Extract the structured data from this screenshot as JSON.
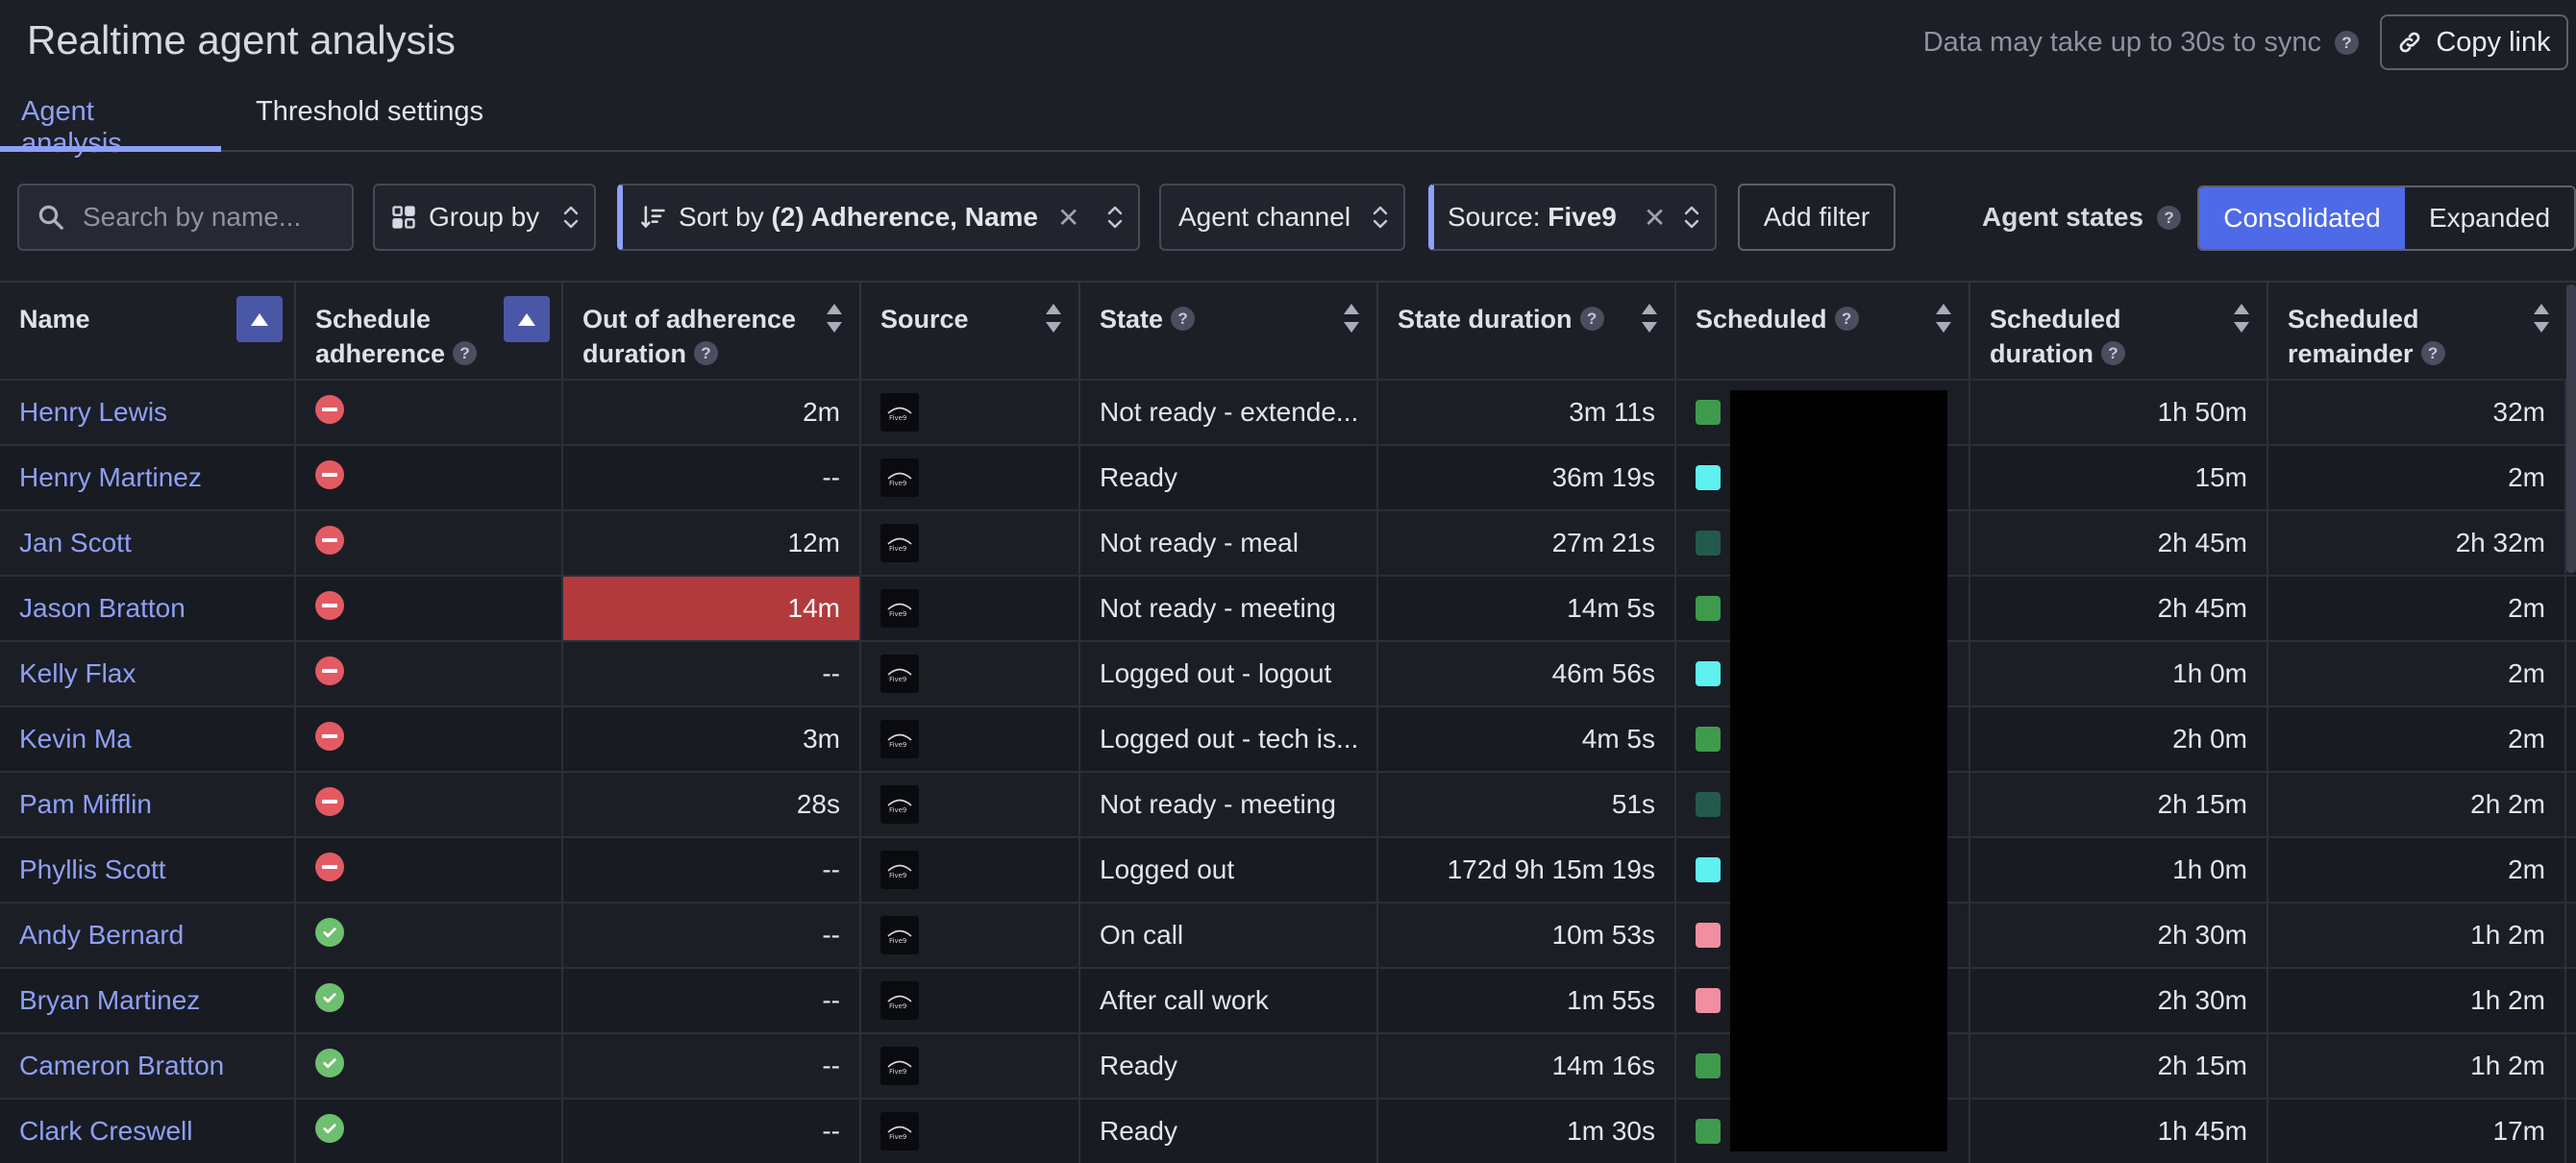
{
  "header": {
    "title": "Realtime agent analysis",
    "sync_note": "Data may take up to 30s to sync",
    "copy_link_label": "Copy link"
  },
  "tabs": [
    {
      "label": "Agent analysis",
      "active": true
    },
    {
      "label": "Threshold settings",
      "active": false
    }
  ],
  "toolbar": {
    "search_placeholder": "Search by name...",
    "group_by_label": "Group by",
    "sort_prefix": "Sort by",
    "sort_value": "(2) Adherence, Name",
    "channel_label": "Agent channel",
    "source_prefix": "Source:",
    "source_value": "Five9",
    "add_filter_label": "Add filter",
    "agent_states_label": "Agent states",
    "view_options": [
      "Consolidated",
      "Expanded"
    ],
    "selected_view": "Consolidated"
  },
  "columns": {
    "name": "Name",
    "adherence_1": "Schedule",
    "adherence_2": "adherence",
    "ooa_1": "Out of adherence",
    "ooa_2": "duration",
    "source": "Source",
    "state": "State",
    "state_duration": "State duration",
    "scheduled": "Scheduled",
    "sched_duration_1": "Scheduled",
    "sched_duration_2": "duration",
    "sched_remainder_1": "Scheduled",
    "sched_remainder_2": "remainder"
  },
  "colors": {
    "accent": "#8ea0f7",
    "primary_button": "#4e6ae8",
    "out_of_adherence": "#e45a63",
    "in_adherence": "#6fbf70",
    "alert_cell": "#b23a3d"
  },
  "rows": [
    {
      "name": "Henry Lewis",
      "adherence": "out",
      "ooa": "2m",
      "source_icon": "five9-logo-icon",
      "state": "Not ready - extende...",
      "state_duration": "3m 11s",
      "scheduled_color": "#3f9a4e",
      "sched_duration": "1h 50m",
      "remainder": "32m"
    },
    {
      "name": "Henry Martinez",
      "adherence": "out",
      "ooa": "--",
      "source_icon": "five9-logo-icon",
      "state": "Ready",
      "state_duration": "36m 19s",
      "scheduled_color": "#5ff0f0",
      "sched_duration": "15m",
      "remainder": "2m"
    },
    {
      "name": "Jan Scott",
      "adherence": "out",
      "ooa": "12m",
      "source_icon": "five9-logo-icon",
      "state": "Not ready - meal",
      "state_duration": "27m 21s",
      "scheduled_color": "#245a4b",
      "sched_duration": "2h 45m",
      "remainder": "2h 32m"
    },
    {
      "name": "Jason Bratton",
      "adherence": "out",
      "ooa": "14m",
      "ooa_alert": true,
      "source_icon": "five9-logo-icon",
      "state": "Not ready - meeting",
      "state_duration": "14m 5s",
      "scheduled_color": "#3f9a4e",
      "sched_duration": "2h 45m",
      "remainder": "2m"
    },
    {
      "name": "Kelly Flax",
      "adherence": "out",
      "ooa": "--",
      "source_icon": "five9-logo-icon",
      "state": "Logged out - logout",
      "state_duration": "46m 56s",
      "scheduled_color": "#5ff0f0",
      "sched_duration": "1h 0m",
      "remainder": "2m"
    },
    {
      "name": "Kevin Ma",
      "adherence": "out",
      "ooa": "3m",
      "source_icon": "five9-logo-icon",
      "state": "Logged out - tech is...",
      "state_duration": "4m 5s",
      "scheduled_color": "#3f9a4e",
      "sched_duration": "2h 0m",
      "remainder": "2m"
    },
    {
      "name": "Pam Mifflin",
      "adherence": "out",
      "ooa": "28s",
      "source_icon": "five9-logo-icon",
      "state": "Not ready - meeting",
      "state_duration": "51s",
      "scheduled_color": "#245a4b",
      "sched_duration": "2h 15m",
      "remainder": "2h 2m"
    },
    {
      "name": "Phyllis Scott",
      "adherence": "out",
      "ooa": "--",
      "source_icon": "five9-logo-icon",
      "state": "Logged out",
      "state_duration": "172d 9h 15m 19s",
      "scheduled_color": "#5ff0f0",
      "sched_duration": "1h 0m",
      "remainder": "2m"
    },
    {
      "name": "Andy Bernard",
      "adherence": "in",
      "ooa": "--",
      "source_icon": "five9-logo-icon",
      "state": "On call",
      "state_duration": "10m 53s",
      "scheduled_color": "#f08fa0",
      "sched_duration": "2h 30m",
      "remainder": "1h 2m"
    },
    {
      "name": "Bryan Martinez",
      "adherence": "in",
      "ooa": "--",
      "source_icon": "five9-logo-icon",
      "state": "After call work",
      "state_duration": "1m 55s",
      "scheduled_color": "#f08fa0",
      "sched_duration": "2h 30m",
      "remainder": "1h 2m"
    },
    {
      "name": "Cameron Bratton",
      "adherence": "in",
      "ooa": "--",
      "source_icon": "five9-logo-icon",
      "state": "Ready",
      "state_duration": "14m 16s",
      "scheduled_color": "#3f9a4e",
      "sched_duration": "2h 15m",
      "remainder": "1h 2m"
    },
    {
      "name": "Clark Creswell",
      "adherence": "in",
      "ooa": "--",
      "source_icon": "five9-logo-icon",
      "state": "Ready",
      "state_duration": "1m 30s",
      "scheduled_color": "#3f9a4e",
      "sched_duration": "1h 45m",
      "remainder": "17m"
    }
  ]
}
